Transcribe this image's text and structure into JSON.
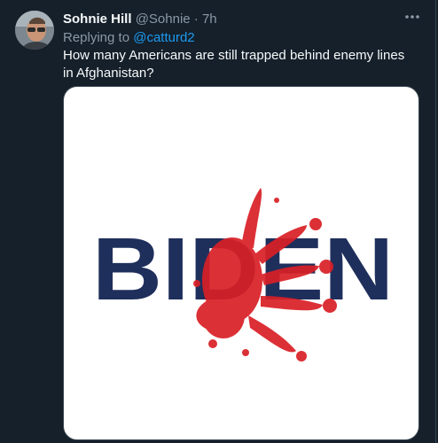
{
  "tweet": {
    "author_name": "Sohnie Hill",
    "author_handle": "@Sohnie",
    "separator": "·",
    "time": "7h",
    "replying_prefix": "Replying to ",
    "replying_to": "@catturd2",
    "text": "How many Americans are still trapped behind enemy lines in Afghanistan?"
  },
  "media": {
    "logo_text": "BIDEN",
    "logo_color": "#1f2f5c",
    "handprint_color": "#d91f26"
  },
  "icons": {
    "more": "more-horizontal-icon"
  },
  "colors": {
    "background": "#15202b",
    "link": "#1d9bf0",
    "secondary_text": "#8b98a5"
  }
}
